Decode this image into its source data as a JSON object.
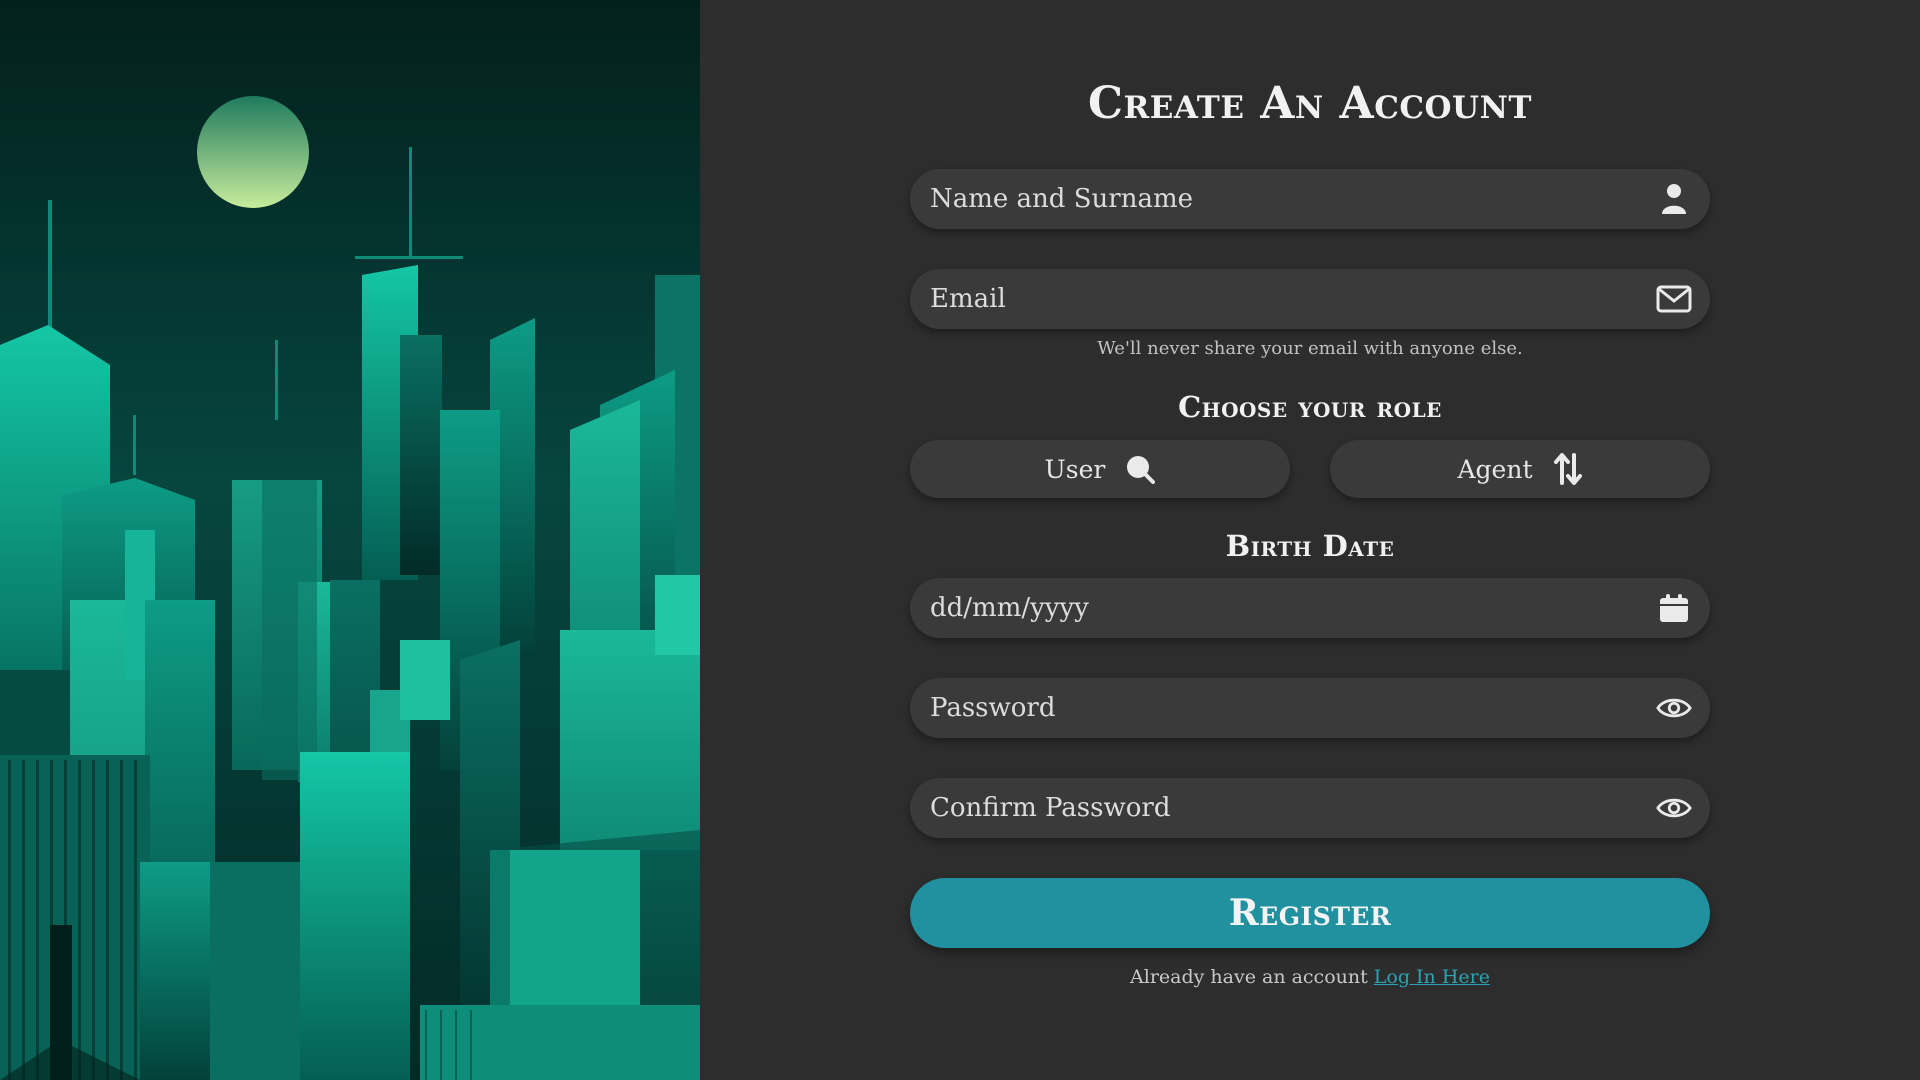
{
  "colors": {
    "panel_background": "#2d2d2d",
    "field_background": "#3a3a3a",
    "accent": "#21909f",
    "link": "#2aa3b3",
    "art_teal": "#0fa88c"
  },
  "form": {
    "title": "Create An Account",
    "fields": {
      "name": {
        "placeholder": "Name and Surname",
        "icon": "person-icon"
      },
      "email": {
        "placeholder": "Email",
        "icon": "envelope-icon"
      },
      "birth_date": {
        "placeholder": "dd/mm/yyyy",
        "icon": "calendar-icon"
      },
      "password": {
        "placeholder": "Password",
        "icon": "eye-icon"
      },
      "confirm_password": {
        "placeholder": "Confirm Password",
        "icon": "eye-icon"
      }
    },
    "email_hint": "We'll never share your email with anyone else.",
    "role_title": "Choose your role",
    "roles": [
      {
        "label": "User",
        "icon": "search-icon"
      },
      {
        "label": "Agent",
        "icon": "sort-arrows-icon"
      }
    ],
    "birth_title": "Birth Date",
    "register_label": "Register",
    "login_prompt": "Already have an account",
    "login_link": "Log In Here"
  }
}
